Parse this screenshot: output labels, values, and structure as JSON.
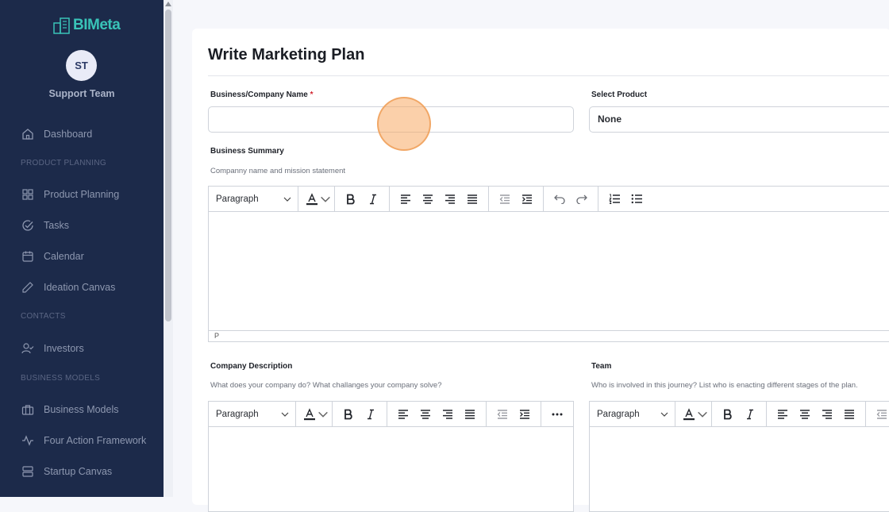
{
  "sidebar": {
    "logo_text": "BIMeta",
    "avatar_initials": "ST",
    "user_name": "Support Team",
    "items": [
      {
        "label": "Dashboard",
        "icon": "home-icon"
      },
      {
        "section": "PRODUCT PLANNING"
      },
      {
        "label": "Product Planning",
        "icon": "grid-icon"
      },
      {
        "label": "Tasks",
        "icon": "check-circle-icon"
      },
      {
        "label": "Calendar",
        "icon": "calendar-icon"
      },
      {
        "label": "Ideation Canvas",
        "icon": "pencil-icon"
      },
      {
        "section": "CONTACTS"
      },
      {
        "label": "Investors",
        "icon": "user-check-icon"
      },
      {
        "section": "BUSINESS MODELS"
      },
      {
        "label": "Business Models",
        "icon": "briefcase-icon"
      },
      {
        "label": "Four Action Framework",
        "icon": "activity-icon"
      },
      {
        "label": "Startup Canvas",
        "icon": "server-icon"
      }
    ]
  },
  "page": {
    "title": "Write Marketing Plan",
    "company_name_label": "Business/Company Name",
    "required_mark": "*",
    "company_name_value": "",
    "select_product_label": "Select Product",
    "select_product_value": "None",
    "business_summary_label": "Business Summary",
    "business_summary_hint": "Companny name and mission statement",
    "company_description_label": "Company Description",
    "company_description_hint": "What does your company do? What challanges your company solve?",
    "team_label": "Team",
    "team_hint": "Who is involved in this journey? List who is enacting different stages of the plan."
  },
  "editor": {
    "block_format": "Paragraph",
    "status_path": "P"
  },
  "colors": {
    "sidebar_bg": "#1c2a4a",
    "brand_teal": "#39c3b8",
    "required_red": "#d1242f",
    "click_indicator": "#f7aa64"
  }
}
